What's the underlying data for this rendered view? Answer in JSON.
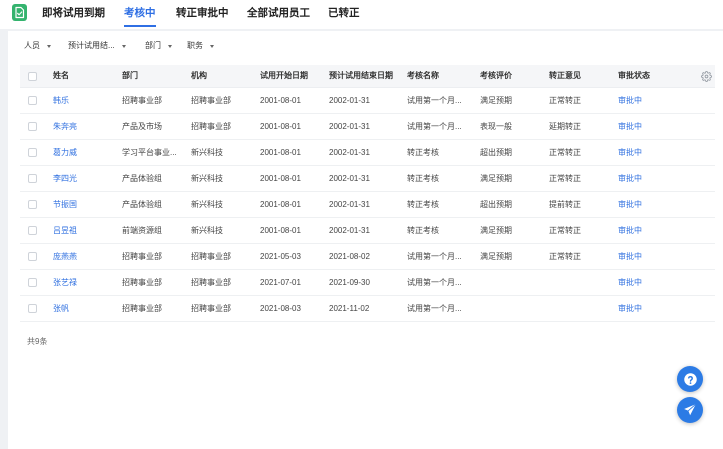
{
  "theme": {
    "accent": "#2f6fe4",
    "link": "#3171e0",
    "logo": "#34b36e",
    "fab": "#2c7be5",
    "text": "#333333"
  },
  "header": {
    "logo_icon": "document-icon"
  },
  "tabs": [
    {
      "label": "即将试用到期",
      "active": false
    },
    {
      "label": "考核中",
      "active": true
    },
    {
      "label": "转正审批中",
      "active": false
    },
    {
      "label": "全部试用员工",
      "active": false
    },
    {
      "label": "已转正",
      "active": false
    }
  ],
  "filters": [
    {
      "label": "人员",
      "icon": "chevron-down-icon"
    },
    {
      "label": "预计试用结...",
      "icon": "chevron-down-icon"
    },
    {
      "label": "部门",
      "icon": "chevron-down-icon"
    },
    {
      "label": "职务",
      "icon": "chevron-down-icon"
    }
  ],
  "table": {
    "columns": [
      "姓名",
      "部门",
      "机构",
      "试用开始日期",
      "预计试用结束日期",
      "考核名称",
      "考核评价",
      "转正意见",
      "审批状态"
    ],
    "settings_icon": "gear-icon",
    "rows": [
      {
        "name": "韩乐",
        "department": "招聘事业部",
        "organization": "招聘事业部",
        "start_date": "2001-08-01",
        "end_date": "2002-01-31",
        "review_name": "试用第一个月...",
        "review_rating": "满足预期",
        "opinion": "正常转正",
        "status": "审批中"
      },
      {
        "name": "朱奔亮",
        "department": "产品及市场",
        "organization": "招聘事业部",
        "start_date": "2001-08-01",
        "end_date": "2002-01-31",
        "review_name": "试用第一个月...",
        "review_rating": "表现一般",
        "opinion": "延期转正",
        "status": "审批中"
      },
      {
        "name": "葛力威",
        "department": "学习平台事业...",
        "organization": "新兴科技",
        "start_date": "2001-08-01",
        "end_date": "2002-01-31",
        "review_name": "转正考核",
        "review_rating": "超出预期",
        "opinion": "正常转正",
        "status": "审批中"
      },
      {
        "name": "李四光",
        "department": "产品体验组",
        "organization": "新兴科技",
        "start_date": "2001-08-01",
        "end_date": "2002-01-31",
        "review_name": "转正考核",
        "review_rating": "满足预期",
        "opinion": "正常转正",
        "status": "审批中"
      },
      {
        "name": "节振国",
        "department": "产品体验组",
        "organization": "新兴科技",
        "start_date": "2001-08-01",
        "end_date": "2002-01-31",
        "review_name": "转正考核",
        "review_rating": "超出预期",
        "opinion": "提前转正",
        "status": "审批中"
      },
      {
        "name": "吕昱祖",
        "department": "前端资源组",
        "organization": "新兴科技",
        "start_date": "2001-08-01",
        "end_date": "2002-01-31",
        "review_name": "转正考核",
        "review_rating": "满足预期",
        "opinion": "正常转正",
        "status": "审批中"
      },
      {
        "name": "庞燕燕",
        "department": "招聘事业部",
        "organization": "招聘事业部",
        "start_date": "2021-05-03",
        "end_date": "2021-08-02",
        "review_name": "试用第一个月...",
        "review_rating": "满足预期",
        "opinion": "正常转正",
        "status": "审批中"
      },
      {
        "name": "张艺禄",
        "department": "招聘事业部",
        "organization": "招聘事业部",
        "start_date": "2021-07-01",
        "end_date": "2021-09-30",
        "review_name": "试用第一个月...",
        "review_rating": "",
        "opinion": "",
        "status": "审批中"
      },
      {
        "name": "张帆",
        "department": "招聘事业部",
        "organization": "招聘事业部",
        "start_date": "2021-08-03",
        "end_date": "2021-11-02",
        "review_name": "试用第一个月...",
        "review_rating": "",
        "opinion": "",
        "status": "审批中"
      }
    ]
  },
  "footer": {
    "total": "共9条"
  },
  "floating_buttons": [
    {
      "icon": "help-icon"
    },
    {
      "icon": "send-icon"
    }
  ]
}
